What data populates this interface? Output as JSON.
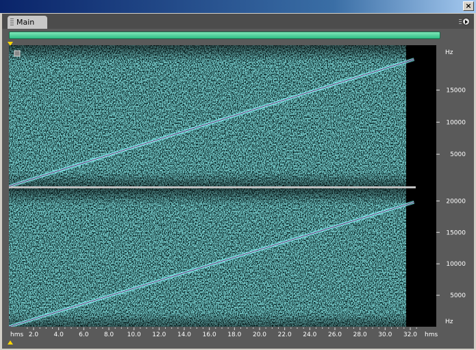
{
  "window": {
    "close_label": "×"
  },
  "panel": {
    "tab_label": "Main"
  },
  "time_ruler": {
    "unit_left": "hms",
    "unit_right": "hms",
    "ticks": [
      "2.0",
      "4.0",
      "6.0",
      "8.0",
      "10.0",
      "12.0",
      "14.0",
      "16.0",
      "18.0",
      "20.0",
      "22.0",
      "24.0",
      "26.0",
      "28.0",
      "30.0",
      "32.0"
    ]
  },
  "freq_ruler_top": {
    "unit": "Hz",
    "ticks": [
      "15000",
      "10000",
      "5000"
    ]
  },
  "freq_ruler_bottom": {
    "unit": "Hz",
    "ticks": [
      "20000",
      "15000",
      "10000",
      "5000"
    ]
  },
  "spectrogram": {
    "top_channel": {
      "sweep_start_hz": 0,
      "sweep_end_hz": 19800,
      "sweep_end_time_s": 32.3
    },
    "bottom_channel": {
      "sweep_start_hz": 0,
      "sweep_end_hz": 19800,
      "sweep_end_time_s": 32.3
    },
    "axis_max_hz": 22000,
    "colors": {
      "noise": "#2b8f8f",
      "sweep": "#b8ffff",
      "sweep_core": "#3a2a70",
      "background": "#000000"
    }
  }
}
